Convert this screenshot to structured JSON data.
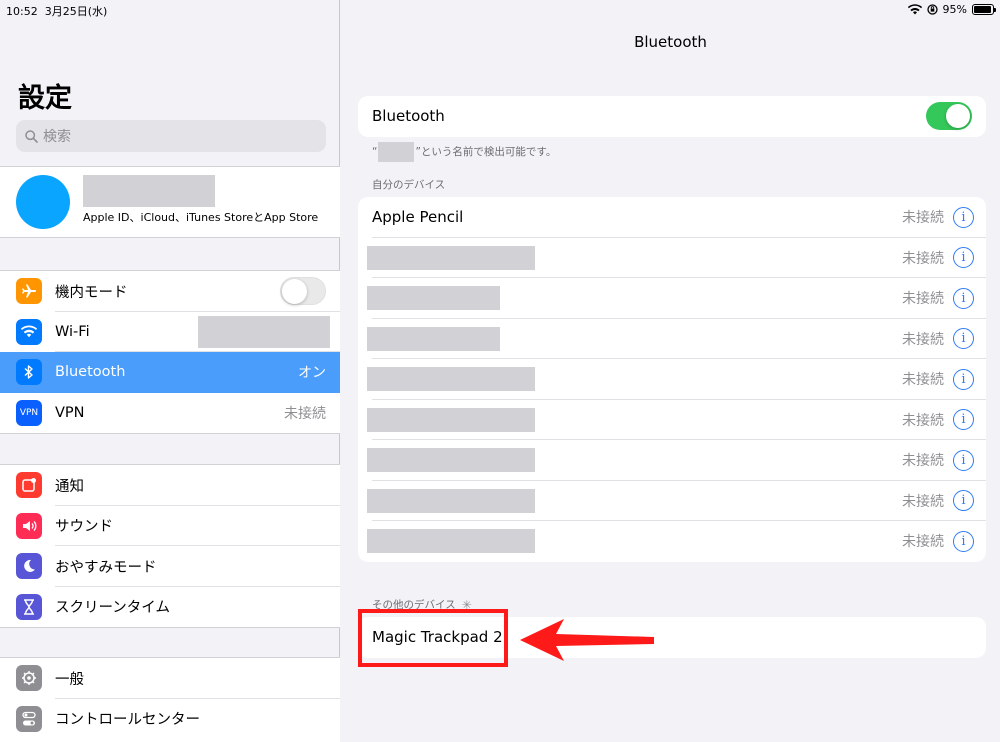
{
  "status_bar": {
    "time": "10:52",
    "date": "3月25日(水)",
    "battery_percent": 95,
    "battery_label": "95%"
  },
  "sidebar": {
    "title": "設定",
    "search_placeholder": "検索",
    "profile": {
      "subtitle": "Apple ID、iCloud、iTunes StoreとApp Store"
    },
    "group1": [
      {
        "label": "機内モード",
        "icon": "airplane-icon",
        "color": "#ff9500",
        "toggle": "off"
      },
      {
        "label": "Wi-Fi",
        "icon": "wifi-icon",
        "color": "#007aff"
      },
      {
        "label": "Bluetooth",
        "icon": "bluetooth-icon",
        "color": "#007aff",
        "value": "オン",
        "selected": true
      },
      {
        "label": "VPN",
        "icon": "vpn-icon",
        "color": "#0a60ff",
        "value": "未接続",
        "icon_text": "VPN"
      }
    ],
    "group2": [
      {
        "label": "通知",
        "icon": "notifications-icon",
        "color": "#ff3b30"
      },
      {
        "label": "サウンド",
        "icon": "sound-icon",
        "color": "#ff2d55"
      },
      {
        "label": "おやすみモード",
        "icon": "moon-icon",
        "color": "#5856d6"
      },
      {
        "label": "スクリーンタイム",
        "icon": "hourglass-icon",
        "color": "#5856d6"
      }
    ],
    "group3": [
      {
        "label": "一般",
        "icon": "gear-icon",
        "color": "#8e8e93"
      },
      {
        "label": "コントロールセンター",
        "icon": "control-center-icon",
        "color": "#8e8e93"
      }
    ]
  },
  "main": {
    "nav_title": "Bluetooth",
    "bluetooth_row": {
      "label": "Bluetooth",
      "state": "on"
    },
    "discoverable_prefix": "“",
    "discoverable_suffix": "”という名前で検出可能です。",
    "my_devices_header": "自分のデバイス",
    "my_devices": [
      {
        "name": "Apple Pencil",
        "status": "未接続"
      },
      {
        "name": "",
        "status": "未接続"
      },
      {
        "name": "",
        "status": "未接続"
      },
      {
        "name": "",
        "status": "未接続"
      },
      {
        "name": "",
        "status": "未接続"
      },
      {
        "name": "",
        "status": "未接続"
      },
      {
        "name": "",
        "status": "未接続"
      },
      {
        "name": "",
        "status": "未接続"
      },
      {
        "name": "",
        "status": "未接続"
      }
    ],
    "info_glyph": "i",
    "other_devices_header": "その他のデバイス",
    "other_devices": [
      {
        "name": "Magic Trackpad 2"
      }
    ]
  },
  "colors": {
    "accent": "#4a9dfa",
    "toggle_on": "#34c759",
    "highlight": "#ff1a1a",
    "info": "#2f7cf6"
  }
}
